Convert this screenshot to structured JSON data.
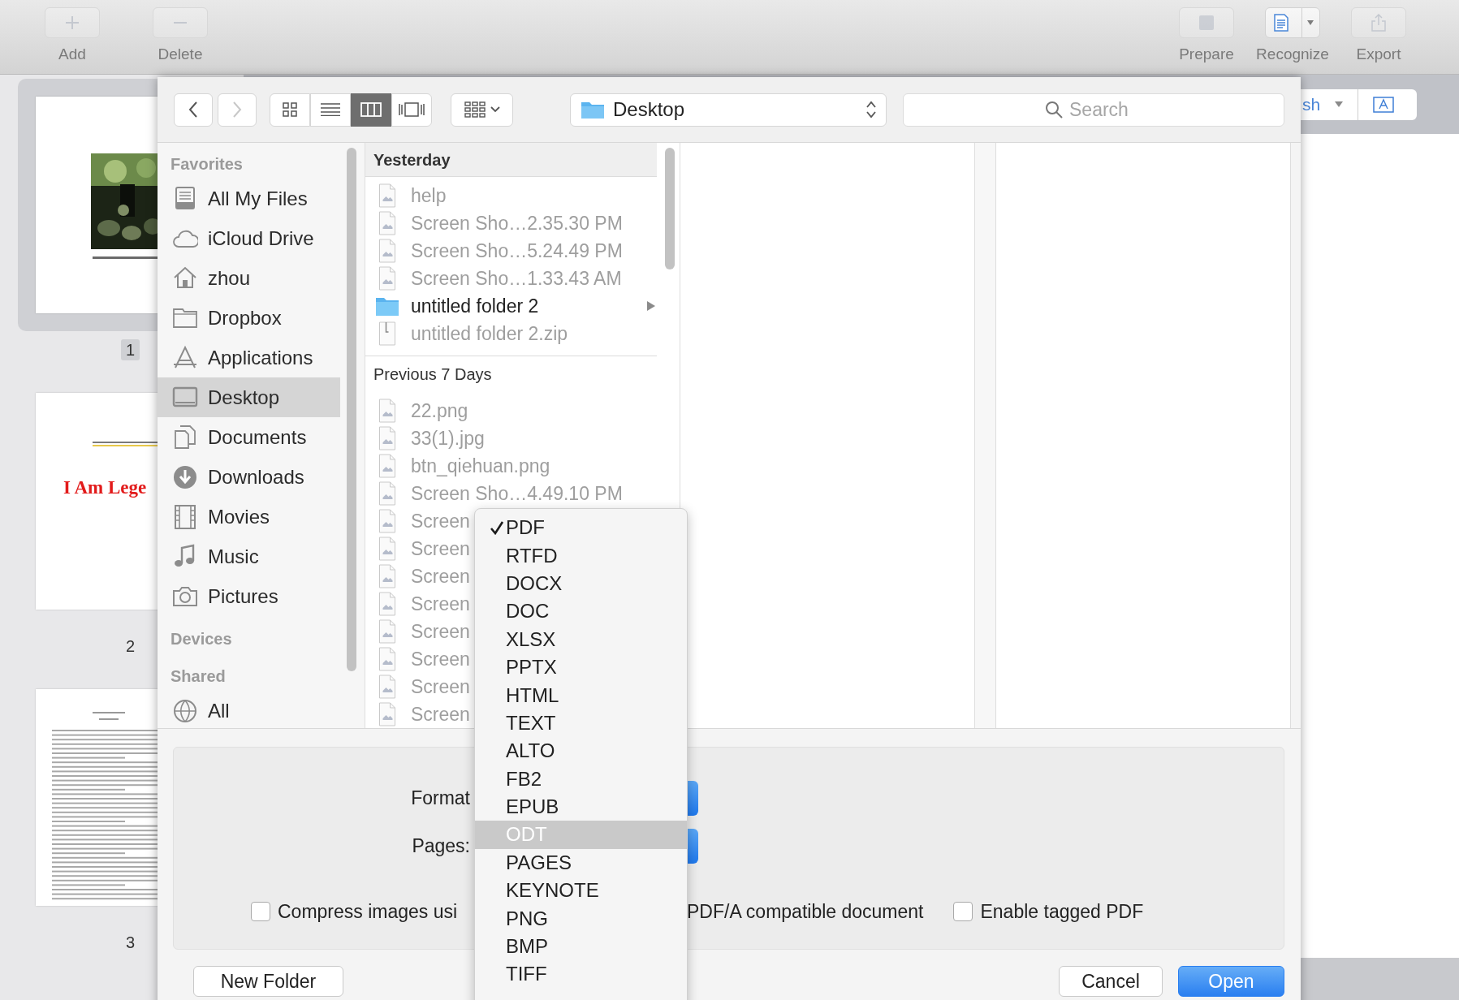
{
  "toolbar": {
    "left_buttons": [
      {
        "label": "Add",
        "disabled": true,
        "split": false
      },
      {
        "label": "Delete",
        "disabled": true,
        "split": false
      }
    ],
    "right_buttons": [
      {
        "label": "Prepare",
        "disabled": true,
        "split": false
      },
      {
        "label": "Recognize",
        "disabled": false,
        "split": true
      },
      {
        "label": "Export",
        "disabled": true,
        "split": false
      }
    ]
  },
  "pages": [
    {
      "number": "1",
      "selected": true,
      "kind": "picture"
    },
    {
      "number": "2",
      "selected": false,
      "kind": "title",
      "title": "I Am Lege"
    },
    {
      "number": "3",
      "selected": false,
      "kind": "text"
    }
  ],
  "behind_bar": {
    "text": "sh"
  },
  "dialog": {
    "view_modes": [
      {
        "selected": false
      },
      {
        "selected": false
      },
      {
        "selected": true
      },
      {
        "selected": false
      }
    ],
    "location": "Desktop",
    "search": {
      "placeholder": "Search"
    },
    "sidebar": [
      {
        "heading": "Favorites",
        "items": [
          {
            "label": "All My Files",
            "selected": false
          },
          {
            "label": "iCloud Drive",
            "selected": false
          },
          {
            "label": "zhou",
            "selected": false
          },
          {
            "label": "Dropbox",
            "selected": false
          },
          {
            "label": "Applications",
            "selected": false
          },
          {
            "label": "Desktop",
            "selected": true
          },
          {
            "label": "Documents",
            "selected": false
          },
          {
            "label": "Downloads",
            "selected": false
          },
          {
            "label": "Movies",
            "selected": false
          },
          {
            "label": "Music",
            "selected": false
          },
          {
            "label": "Pictures",
            "selected": false
          }
        ]
      },
      {
        "heading": "Devices"
      },
      {
        "heading": "Shared",
        "items": [
          {
            "label": "All",
            "selected": false
          }
        ]
      }
    ],
    "file_groups": [
      {
        "heading": "Yesterday",
        "items": [
          {
            "name": "help",
            "kind": "file",
            "disabled": true
          },
          {
            "name": "Screen Sho…2.35.30 PM",
            "kind": "file",
            "disabled": true
          },
          {
            "name": "Screen Sho…5.24.49 PM",
            "kind": "file",
            "disabled": true
          },
          {
            "name": "Screen Sho…1.33.43 AM",
            "kind": "file",
            "disabled": true
          },
          {
            "name": "untitled folder 2",
            "kind": "folder",
            "disabled": false
          },
          {
            "name": "untitled folder 2.zip",
            "kind": "archive",
            "disabled": true
          }
        ]
      },
      {
        "heading": "Previous 7 Days",
        "items": [
          {
            "name": "22.png",
            "kind": "file",
            "disabled": true
          },
          {
            "name": "33(1).jpg",
            "kind": "file",
            "disabled": true
          },
          {
            "name": "btn_qiehuan.png",
            "kind": "file",
            "disabled": true
          },
          {
            "name": "Screen Sho…4.49.10 PM",
            "kind": "file",
            "disabled": true
          },
          {
            "name": "Screen",
            "kind": "file",
            "disabled": true
          },
          {
            "name": "Screen",
            "kind": "file",
            "disabled": true
          },
          {
            "name": "Screen",
            "kind": "file",
            "disabled": true
          },
          {
            "name": "Screen",
            "kind": "file",
            "disabled": true
          },
          {
            "name": "Screen",
            "kind": "file",
            "disabled": true
          },
          {
            "name": "Screen",
            "kind": "file",
            "disabled": true
          },
          {
            "name": "Screen",
            "kind": "file",
            "disabled": true
          },
          {
            "name": "Screen",
            "kind": "file",
            "disabled": true
          }
        ]
      }
    ],
    "options": {
      "format_label": "Format",
      "pages_label": "Pages:",
      "compress": {
        "label": "Compress images usi",
        "checked": false
      },
      "pdfa_text": "PDF/A compatible document",
      "tagged": {
        "label": "Enable tagged PDF",
        "checked": false
      }
    },
    "buttons": [
      {
        "label": "New Folder",
        "default": false
      },
      {
        "label": "Cancel",
        "default": false
      },
      {
        "label": "Open",
        "default": true
      }
    ],
    "format_menu": {
      "items": [
        {
          "label": "PDF",
          "checked": true,
          "highlighted": false
        },
        {
          "label": "RTFD",
          "checked": false,
          "highlighted": false
        },
        {
          "label": "DOCX",
          "checked": false,
          "highlighted": false
        },
        {
          "label": "DOC",
          "checked": false,
          "highlighted": false
        },
        {
          "label": "XLSX",
          "checked": false,
          "highlighted": false
        },
        {
          "label": "PPTX",
          "checked": false,
          "highlighted": false
        },
        {
          "label": "HTML",
          "checked": false,
          "highlighted": false
        },
        {
          "label": "TEXT",
          "checked": false,
          "highlighted": false
        },
        {
          "label": "ALTO",
          "checked": false,
          "highlighted": false
        },
        {
          "label": "FB2",
          "checked": false,
          "highlighted": false
        },
        {
          "label": "EPUB",
          "checked": false,
          "highlighted": false
        },
        {
          "label": "ODT",
          "checked": false,
          "highlighted": true
        },
        {
          "label": "PAGES",
          "checked": false,
          "highlighted": false
        },
        {
          "label": "KEYNOTE",
          "checked": false,
          "highlighted": false
        },
        {
          "label": "PNG",
          "checked": false,
          "highlighted": false
        },
        {
          "label": "BMP",
          "checked": false,
          "highlighted": false
        },
        {
          "label": "TIFF",
          "checked": false,
          "highlighted": false
        }
      ]
    }
  }
}
